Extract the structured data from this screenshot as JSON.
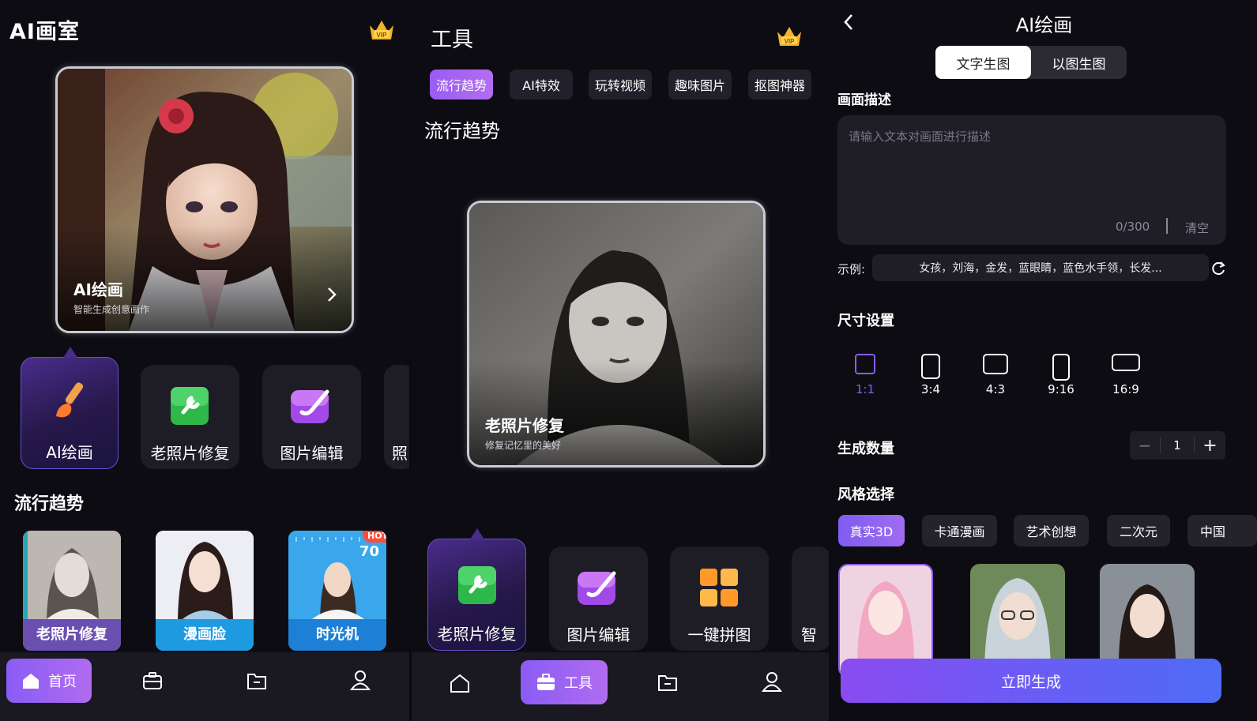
{
  "panel1": {
    "title": "AI画室",
    "vip_badge": "VIP",
    "hero": {
      "title": "AI绘画",
      "subtitle": "智能生成创意画作"
    },
    "tools": [
      {
        "label": "AI绘画",
        "icon": "paintbrush-icon"
      },
      {
        "label": "老照片修复",
        "icon": "wrench-icon"
      },
      {
        "label": "图片编辑",
        "icon": "pen-edit-icon"
      },
      {
        "label": "照"
      }
    ],
    "trending_title": "流行趋势",
    "trending": [
      {
        "label": "老照片修复"
      },
      {
        "label": "漫画脸"
      },
      {
        "label": "时光机",
        "badge": "HOT",
        "age": "70"
      }
    ],
    "nav": {
      "home_label": "首页"
    }
  },
  "panel2": {
    "title": "工具",
    "vip_badge": "VIP",
    "chips": [
      "流行趋势",
      "AI特效",
      "玩转视频",
      "趣味图片",
      "抠图神器"
    ],
    "section_title": "流行趋势",
    "feature": {
      "title": "老照片修复",
      "subtitle": "修复记忆里的美好"
    },
    "tools": [
      {
        "label": "老照片修复",
        "icon": "wrench-icon"
      },
      {
        "label": "图片编辑",
        "icon": "pen-edit-icon"
      },
      {
        "label": "一键拼图",
        "icon": "collage-icon"
      },
      {
        "label": "智"
      }
    ],
    "nav": {
      "tools_label": "工具"
    }
  },
  "panel3": {
    "title": "AI绘画",
    "segments": [
      "文字生图",
      "以图生图"
    ],
    "desc_label": "画面描述",
    "desc_placeholder": "请输入文本对画面进行描述",
    "char_count": "0/300",
    "clear_label": "清空",
    "example_label": "示例:",
    "example_text": "女孩，刘海，金发，蓝眼睛，蓝色水手领，长发...",
    "size_label": "尺寸设置",
    "ratios": [
      "1:1",
      "3:4",
      "4:3",
      "9:16",
      "16:9"
    ],
    "count_label": "生成数量",
    "count_value": "1",
    "count_minus": "−",
    "count_plus": "+",
    "style_label": "风格选择",
    "styles": [
      "真实3D",
      "卡通漫画",
      "艺术创想",
      "二次元",
      "中国"
    ],
    "generate_label": "立即生成"
  },
  "colors": {
    "accent": "#9a5cf2",
    "background": "#0d0c12",
    "card": "#1e1d26",
    "hot": "#ff4b3a",
    "trend_blue": "#1e9be0"
  }
}
